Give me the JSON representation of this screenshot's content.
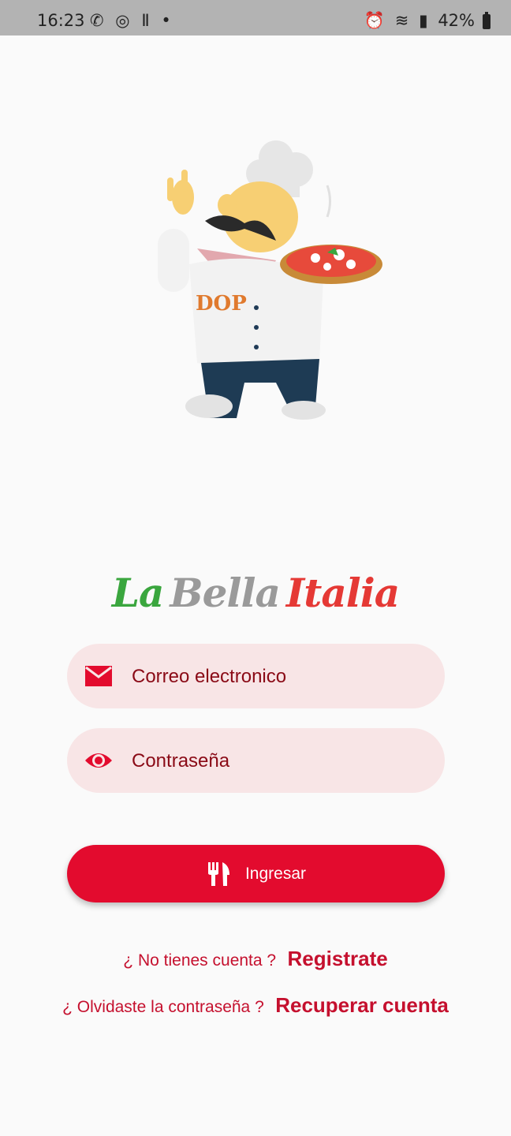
{
  "status_bar": {
    "time": "16:23",
    "battery": "42%",
    "left_icons": [
      "missed-call-icon",
      "whatsapp-icon",
      "app-icon",
      "dot-icon"
    ],
    "right_icons": [
      "alarm-icon",
      "wifi-icon",
      "signal-icon",
      "battery-icon"
    ]
  },
  "logo": {
    "word1": "La",
    "word2": "Bella",
    "word3": "Italia"
  },
  "form": {
    "email_placeholder": "Correo electronico",
    "password_placeholder": "Contraseña",
    "email_value": "",
    "password_value": ""
  },
  "login_button": {
    "label": "Ingresar"
  },
  "register": {
    "question": "¿ No tienes cuenta ?",
    "link": "Registrate"
  },
  "recover": {
    "question": "¿ Olvidaste la contraseña ?",
    "link": "Recuperar cuenta"
  },
  "colors": {
    "accent": "#e30b2e",
    "field_bg": "#f8e5e6",
    "text_red": "#c5102e",
    "logo_green": "#3aa63e",
    "logo_gray": "#9a9a9a",
    "logo_red": "#e53935"
  }
}
